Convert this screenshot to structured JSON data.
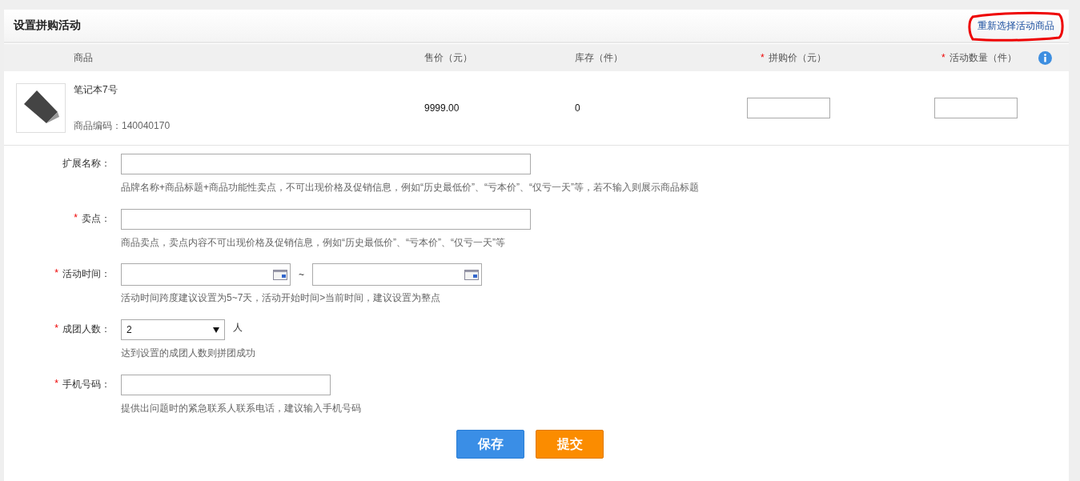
{
  "panel": {
    "title": "设置拼购活动",
    "reselect_link": "重新选择活动商品"
  },
  "table": {
    "columns": [
      {
        "label": "商品"
      },
      {
        "label": "售价（元）"
      },
      {
        "label": "库存（件）"
      },
      {
        "label": "拼购价（元）",
        "required_mark": "*"
      },
      {
        "label": "活动数量（件）",
        "required_mark": "*"
      }
    ],
    "rows": [
      {
        "name": "笔记本7号",
        "code": "商品编码：140040170",
        "price": "9999.00",
        "stock": "0"
      }
    ]
  },
  "form": [
    {
      "kind": "text",
      "label": "扩展名称：",
      "hint": "品牌名称+商品标题+商品功能性卖点，不可出现价格及促销信息，例如“历史最低价”、“亏本价”、“仅亏一天”等，若不输入则展示商品标题"
    },
    {
      "kind": "text",
      "label": "卖点：",
      "required_mark": "*",
      "hint": "商品卖点，卖点内容不可出现价格及促销信息，例如“历史最低价”、“亏本价”、“仅亏一天”等"
    },
    {
      "kind": "daterange",
      "label": "活动时间：",
      "required_mark": "*",
      "separator": "~",
      "hint": "活动时间跨度建议设置为5~7天，活动开始时间>当前时间，建议设置为整点"
    },
    {
      "kind": "select",
      "label": "成团人数：",
      "required_mark": "*",
      "value": "2",
      "unit": "人",
      "hint": "达到设置的成团人数则拼团成功"
    },
    {
      "kind": "phone",
      "label": "手机号码：",
      "required_mark": "*",
      "hint": "提供出问题时的紧急联系人联系电话，建议输入手机号码"
    }
  ],
  "buttons": [
    {
      "label": "保存",
      "kind": "primary"
    },
    {
      "label": "提交",
      "kind": "warning"
    }
  ]
}
